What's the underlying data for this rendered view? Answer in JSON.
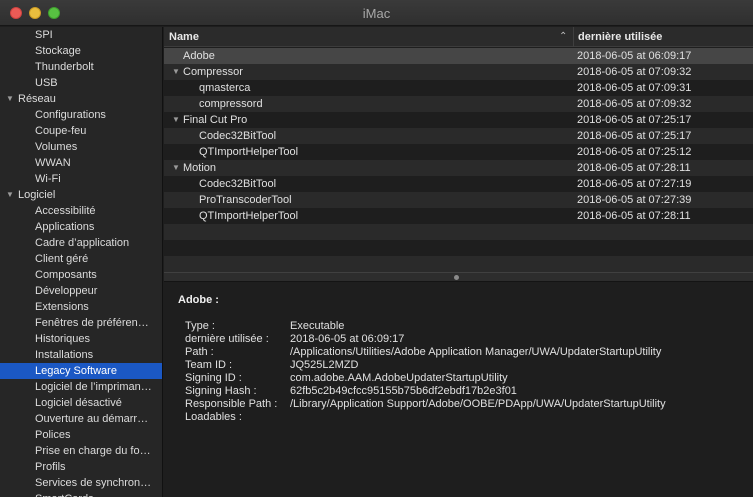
{
  "window": {
    "title": "iMac"
  },
  "colors": {
    "selection": "#1b58c4",
    "close": "#ec5b56",
    "minimize": "#e9bd3e",
    "maximize": "#58c042"
  },
  "sidebar": {
    "items": [
      {
        "label": "SPI",
        "kind": "child"
      },
      {
        "label": "Stockage",
        "kind": "child"
      },
      {
        "label": "Thunderbolt",
        "kind": "child"
      },
      {
        "label": "USB",
        "kind": "child"
      },
      {
        "label": "Réseau",
        "kind": "group"
      },
      {
        "label": "Configurations",
        "kind": "child"
      },
      {
        "label": "Coupe-feu",
        "kind": "child"
      },
      {
        "label": "Volumes",
        "kind": "child"
      },
      {
        "label": "WWAN",
        "kind": "child"
      },
      {
        "label": "Wi-Fi",
        "kind": "child"
      },
      {
        "label": "Logiciel",
        "kind": "group"
      },
      {
        "label": "Accessibilité",
        "kind": "child"
      },
      {
        "label": "Applications",
        "kind": "child"
      },
      {
        "label": "Cadre d’application",
        "kind": "child"
      },
      {
        "label": "Client géré",
        "kind": "child"
      },
      {
        "label": "Composants",
        "kind": "child"
      },
      {
        "label": "Développeur",
        "kind": "child"
      },
      {
        "label": "Extensions",
        "kind": "child"
      },
      {
        "label": "Fenêtres de préféren…",
        "kind": "child"
      },
      {
        "label": "Historiques",
        "kind": "child"
      },
      {
        "label": "Installations",
        "kind": "child"
      },
      {
        "label": "Legacy Software",
        "kind": "child",
        "selected": true
      },
      {
        "label": "Logiciel de l’impriman…",
        "kind": "child"
      },
      {
        "label": "Logiciel désactivé",
        "kind": "child"
      },
      {
        "label": "Ouverture au démarr…",
        "kind": "child"
      },
      {
        "label": "Polices",
        "kind": "child"
      },
      {
        "label": "Prise en charge du fo…",
        "kind": "child"
      },
      {
        "label": "Profils",
        "kind": "child"
      },
      {
        "label": "Services de synchron…",
        "kind": "child"
      },
      {
        "label": "SmartCards",
        "kind": "child"
      }
    ]
  },
  "table": {
    "headers": {
      "name": "Name",
      "date": "dernière utilisée"
    },
    "sort_icon": "chevron-up-icon",
    "rows": [
      {
        "name": "Adobe",
        "date": "2018-06-05 at 06:09:17",
        "level": 0,
        "group": false,
        "selected": true
      },
      {
        "name": "Compressor",
        "date": "2018-06-05 at 07:09:32",
        "level": 0,
        "group": true
      },
      {
        "name": "qmasterca",
        "date": "2018-06-05 at 07:09:31",
        "level": 1
      },
      {
        "name": "compressord",
        "date": "2018-06-05 at 07:09:32",
        "level": 1
      },
      {
        "name": "Final Cut Pro",
        "date": "2018-06-05 at 07:25:17",
        "level": 0,
        "group": true
      },
      {
        "name": "Codec32BitTool",
        "date": "2018-06-05 at 07:25:17",
        "level": 1
      },
      {
        "name": "QTImportHelperTool",
        "date": "2018-06-05 at 07:25:12",
        "level": 1
      },
      {
        "name": "Motion",
        "date": "2018-06-05 at 07:28:11",
        "level": 0,
        "group": true
      },
      {
        "name": "Codec32BitTool",
        "date": "2018-06-05 at 07:27:19",
        "level": 1
      },
      {
        "name": "ProTranscoderTool",
        "date": "2018-06-05 at 07:27:39",
        "level": 1
      },
      {
        "name": "QTImportHelperTool",
        "date": "2018-06-05 at 07:28:11",
        "level": 1
      },
      {
        "name": "",
        "date": ""
      },
      {
        "name": "",
        "date": ""
      },
      {
        "name": "",
        "date": ""
      }
    ]
  },
  "detail": {
    "title": "Adobe :",
    "fields": [
      {
        "key": "Type :",
        "value": "Executable"
      },
      {
        "key": "dernière utilisée :",
        "value": "2018-06-05 at 06:09:17"
      },
      {
        "key": "Path :",
        "value": "/Applications/Utilities/Adobe Application Manager/UWA/UpdaterStartupUtility"
      },
      {
        "key": "Team ID :",
        "value": "JQ525L2MZD"
      },
      {
        "key": "Signing ID :",
        "value": "com.adobe.AAM.AdobeUpdaterStartupUtility"
      },
      {
        "key": "Signing Hash :",
        "value": "62fb5c2b49cfcc95155b75b6df2ebdf17b2e3f01"
      },
      {
        "key": "Responsible Path :",
        "value": "/Library/Application Support/Adobe/OOBE/PDApp/UWA/UpdaterStartupUtility"
      },
      {
        "key": "Loadables :",
        "value": ""
      }
    ]
  }
}
